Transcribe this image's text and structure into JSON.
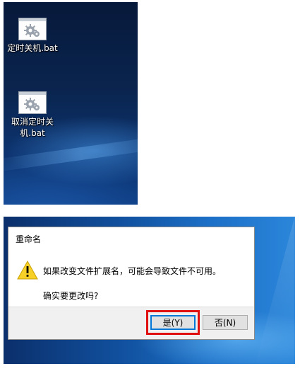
{
  "desktop_icons": [
    {
      "icon": "batch-file-icon",
      "label_lines": [
        "定时关机.bat"
      ]
    },
    {
      "icon": "batch-file-icon",
      "label_lines": [
        "取消定时关",
        "机.bat"
      ]
    }
  ],
  "dialog": {
    "title": "重命名",
    "icon": "warning-icon",
    "message": "如果改变文件扩展名，可能会导致文件不可用。",
    "question": "确实要更改吗?",
    "yes_label": "是(Y)",
    "no_label": "否(N)"
  },
  "colors": {
    "highlight_box": "#e01010",
    "focus_border": "#0078d7",
    "warning_yellow": "#f7d028"
  }
}
